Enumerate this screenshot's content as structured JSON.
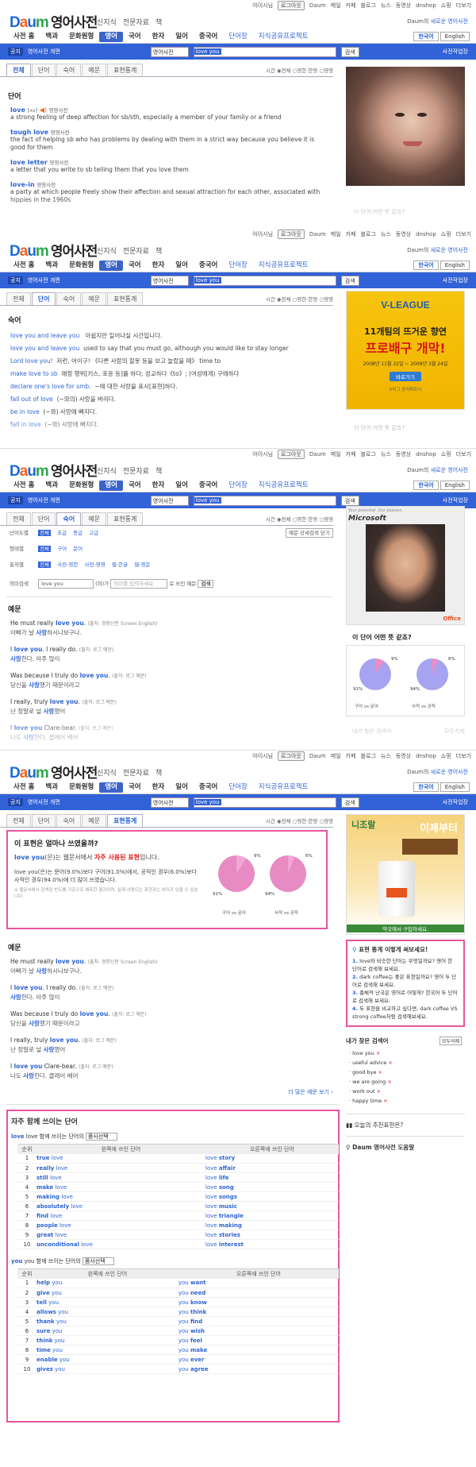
{
  "util": {
    "user": "아이시님",
    "logout": "로그아웃",
    "links": [
      "Daum",
      "메일",
      "카페",
      "블로그",
      "뉴스",
      "동영상",
      "dnshop",
      "쇼핑"
    ],
    "more": "더보기"
  },
  "header": {
    "logo_brand": "Daum",
    "logo_title": "영어사전",
    "links": [
      "신지식",
      "전문자료",
      "책"
    ],
    "new_service_prefix": "Daum의",
    "new_service_link": "새로운 영어사전"
  },
  "nav": {
    "items": [
      "사전 홈",
      "백과",
      "문화원형",
      "영어",
      "국어",
      "한자",
      "일어",
      "중국어",
      "단어장",
      "지식공유프로젝트"
    ],
    "new_badge": "NEW",
    "lang": [
      "한국어",
      "English"
    ]
  },
  "search": {
    "notice_badge": "공지",
    "notice_text": "영어사전 개편",
    "select": "영어사전",
    "query": "love you",
    "submit": "검색",
    "setting": "사전작업장"
  },
  "tabs": {
    "labels": [
      "전체",
      "단어",
      "숙어",
      "예문",
      "표현통계"
    ],
    "range_label": "시간",
    "range_opts": [
      "전체",
      "영한·한영",
      "영영"
    ]
  },
  "s1": {
    "section": "단어",
    "entries": [
      {
        "word": "love",
        "pos": "[ʌv]",
        "src": "영영사전",
        "def": "a strong feeling of deep affection for sb/sth, especially a member of your family or a friend"
      },
      {
        "word": "tough love",
        "pos": "",
        "src": "영영사전",
        "def": "the fact of helping sb who has problems by dealing with them in a strict way because you believe it is good for them"
      },
      {
        "word": "love letter",
        "pos": "",
        "src": "영영사전",
        "def": "a letter that you write to sb telling them that you love them"
      },
      {
        "word": "love-in",
        "pos": "",
        "src": "영영사전",
        "def": "a party at which people freely show their affection and sexual attraction for each other, associated with hippies in the 1960s"
      }
    ],
    "side_caption": "이 단어 어떤 뜻 같죠?"
  },
  "s2": {
    "section": "숙어",
    "idioms": [
      {
        "en": "love you and leave you",
        "kr": "아쉽지만 일어나실 시간입니다."
      },
      {
        "en": "love you and leave you",
        "kr": "used to say that you must go, although you would like to stay longer"
      },
      {
        "en": "Lord love you!",
        "kr": "저런, 어이구! 《다른 사람의 잘못 등을 보고 놀랐을 때》 time to"
      },
      {
        "en": "make love to sb",
        "kr": "애정 행위[키스, 포옹 등]를 하다; 성교하다《to》; (여성에게) 구애하다"
      },
      {
        "en": "declare one's love for smb.",
        "kr": "~에 대한 사랑을 표시[표현]하다."
      },
      {
        "en": "fall out of love",
        "kr": "(~와의) 사랑을 버리다."
      },
      {
        "en": "be in love",
        "kr": "(~와) 사랑에 빠지다."
      },
      {
        "en": "fall in love",
        "kr": "(~와) 사랑에 빠지다."
      }
    ],
    "ad_title1": "11개팀의 뜨거운 향연",
    "ad_title2": "프로배구 개막!",
    "ad_date": "2008년 11월 22일 ~ 2009년 3월 24일",
    "ad_btn": "바로가기",
    "ad_league": "V-LEAGUE",
    "ad_caption": "V리그 공식파트너"
  },
  "s3": {
    "filters": [
      {
        "label": "난이도별",
        "opts": [
          "전체",
          "초급",
          "중급",
          "고급"
        ]
      },
      {
        "label": "형태별",
        "opts": [
          "전체",
          "구어",
          "문어"
        ]
      },
      {
        "label": "출처별",
        "opts": [
          "전체",
          "사전-영한",
          "사전-영영",
          "웹-한글",
          "웹-영문"
        ]
      }
    ],
    "detail_btn": "예문 상세검색 닫기",
    "meaning_label": "의미검색",
    "meaning_value": "love you",
    "meaning_mid": "(이)가",
    "meaning_placeholder": "의미를 입력하세요",
    "meaning_tail": "로 쓰인 예문",
    "meaning_btn": "검색",
    "section": "예문",
    "ad_top": "Your potential. Our passion.",
    "ad_brand": "Microsoft",
    "ad_office": "Office",
    "q_title": "이 단어 어떤 뜻 같죠?",
    "pie1": {
      "a": "9%",
      "b": "91%",
      "legend": "구어 vs 문어"
    },
    "pie2": {
      "a": "6%",
      "b": "94%",
      "legend": "사적 vs 공적"
    },
    "recent": "내가 찾은 검색어",
    "recent_btn": "모두삭제"
  },
  "examples": [
    {
      "en": "He must really love you.",
      "src": "(출처: 경향신문 Screen English)",
      "kr": "아빠가 날 사랑하시나보구나."
    },
    {
      "en": "I love you. I really do.",
      "src": "(출처: 로그 예문)",
      "kr": "사랑한다. 아주 많이"
    },
    {
      "en": "Was because I truly do love you.",
      "src": "(출처: 로그 예문)",
      "kr": "당신을 사랑했기 때문이라고"
    },
    {
      "en": "I really, truly love you.",
      "src": "(출처: 로그 예문)",
      "kr": "난 정말로 널 사랑했어"
    },
    {
      "en": "I love you Clare-bear.",
      "src": "(출처: 로그 예문)",
      "kr": "나도 사랑한다. 클레어 베어"
    }
  ],
  "s4": {
    "pink_q": "이 표현은 얼마나 쓰였을까?",
    "pink_line1a": "love you",
    "pink_line1b": "(은)는 웹문서에서",
    "pink_line1c": "자주 사용된 표현",
    "pink_line1d": "입니다.",
    "pink_line2": "love you(은)는 문어(9.0%)보다 구어(91.0%)에서, 공적인 경우(6.0%)보다 사적인 경우(94.0%)에 더 많이 쓰였습니다.",
    "pink_note": "※ 웹문서에서 검색된 빈도를 기준으로 예측한 결과이며, 실제 사용되는 표현과는 차이가 있을 수 있습니다.",
    "more_examples": "더 많은 예문 보기",
    "co_title": "자주 함께 쓰이는 단어",
    "co1_head": "love 함께 쓰이는 단어의",
    "co2_head": "you 함께 쓰이는 단어의",
    "co_select": "품사선택",
    "col_no": "순위",
    "col_left": "왼쪽에 쓰인 단어",
    "col_right": "오른쪽에 쓰인 단어",
    "co_love": [
      [
        "true",
        "story"
      ],
      [
        "really",
        "affair"
      ],
      [
        "still",
        "life"
      ],
      [
        "make",
        "song"
      ],
      [
        "making",
        "songs"
      ],
      [
        "absolutely",
        "music"
      ],
      [
        "find",
        "triangle"
      ],
      [
        "people",
        "making"
      ],
      [
        "great",
        "stories"
      ],
      [
        "unconditional",
        "interest"
      ]
    ],
    "co_you": [
      [
        "help",
        "want"
      ],
      [
        "give",
        "need"
      ],
      [
        "tell",
        "know"
      ],
      [
        "allows",
        "think"
      ],
      [
        "thank",
        "find"
      ],
      [
        "sure",
        "wish"
      ],
      [
        "think",
        "feel"
      ],
      [
        "time",
        "make"
      ],
      [
        "enable",
        "ever"
      ],
      [
        "gives",
        "agree"
      ]
    ],
    "ad_brand": "니조랄",
    "ad_slogan": "이제부터",
    "ad_bottom": "약국에서 구입하세요.",
    "tips_title": "표현 통계 이렇게 써보세요!",
    "tips": [
      "love와 비슷한 단어는 무엇일까요? 영어 한 단어로 검색해 보세요.",
      "dark coffee는 좋은 표현일까요? 영어 두 단어로 검색해 보세요.",
      "총체적 난국은 영어로 어떻게? 한국어 두 단어로 검색해 보세요.",
      "두 표현을 비교하고 싶다면, dark coffee VS strong coffee처럼 검색해보세요."
    ],
    "recent_title": "내가 찾은 검색어",
    "recent_btn": "모두삭제",
    "recent": [
      "love you",
      "useful advice",
      "good bye",
      "we are going",
      "work out",
      "happy time"
    ],
    "rec_title": "오늘의 추천표현은?",
    "help_title": "Daum 영어사전 도움말"
  },
  "colors": {
    "accent": "#3162d8",
    "link": "#2f65d3",
    "pink": "#e8559e"
  }
}
